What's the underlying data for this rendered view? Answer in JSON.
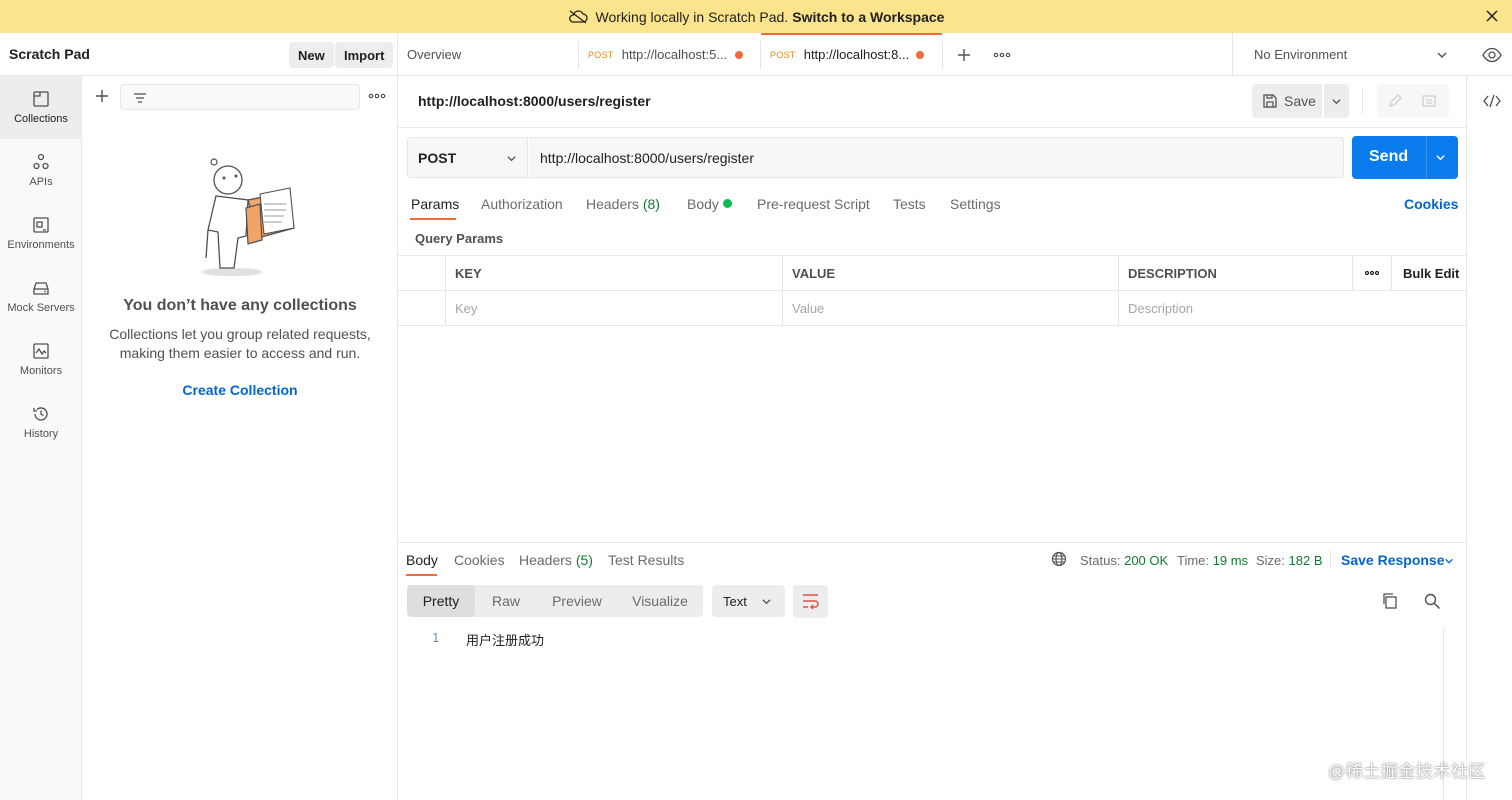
{
  "banner": {
    "text": "Working locally in Scratch Pad.",
    "link": "Switch to a Workspace"
  },
  "sidebar": {
    "title": "Scratch Pad",
    "new_label": "New",
    "import_label": "Import",
    "nav": [
      {
        "label": "Collections",
        "icon": "collections-icon"
      },
      {
        "label": "APIs",
        "icon": "apis-icon"
      },
      {
        "label": "Environments",
        "icon": "environments-icon"
      },
      {
        "label": "Mock Servers",
        "icon": "mock-servers-icon"
      },
      {
        "label": "Monitors",
        "icon": "monitors-icon"
      },
      {
        "label": "History",
        "icon": "history-icon"
      }
    ],
    "empty_title": "You don’t have any collections",
    "empty_desc": "Collections let you group related requests, making them easier to access and run.",
    "create_link": "Create Collection"
  },
  "tabs": [
    {
      "label": "Overview"
    },
    {
      "method": "POST",
      "label": "http://localhost:5..."
    },
    {
      "method": "POST",
      "label": "http://localhost:8..."
    }
  ],
  "environment": "No Environment",
  "request": {
    "title": "http://localhost:8000/users/register",
    "save_label": "Save",
    "method": "POST",
    "url": "http://localhost:8000/users/register",
    "send_label": "Send",
    "tabs": {
      "params": "Params",
      "authorization": "Authorization",
      "headers": "Headers",
      "headers_count": "(8)",
      "body": "Body",
      "prerequest": "Pre-request Script",
      "tests": "Tests",
      "settings": "Settings"
    },
    "cookies_label": "Cookies",
    "query_params_label": "Query Params",
    "table": {
      "headers": [
        "KEY",
        "VALUE",
        "DESCRIPTION"
      ],
      "bulk_edit": "Bulk Edit",
      "placeholders": [
        "Key",
        "Value",
        "Description"
      ]
    }
  },
  "response": {
    "tabs": {
      "body": "Body",
      "cookies": "Cookies",
      "headers": "Headers",
      "headers_count": "(5)",
      "test_results": "Test Results"
    },
    "status_label": "Status:",
    "status_value": "200 OK",
    "time_label": "Time:",
    "time_value": "19 ms",
    "size_label": "Size:",
    "size_value": "182 B",
    "save_response": "Save Response",
    "views": [
      "Pretty",
      "Raw",
      "Preview",
      "Visualize"
    ],
    "format": "Text",
    "line_number": "1",
    "body_text": "用户注册成功"
  },
  "watermark": "@稀土掘金技术社区",
  "colors": {
    "banner": "#fce48c",
    "accent": "#f26b3a",
    "send": "#097bed",
    "link": "#0265d2",
    "success": "#0f7b30"
  }
}
